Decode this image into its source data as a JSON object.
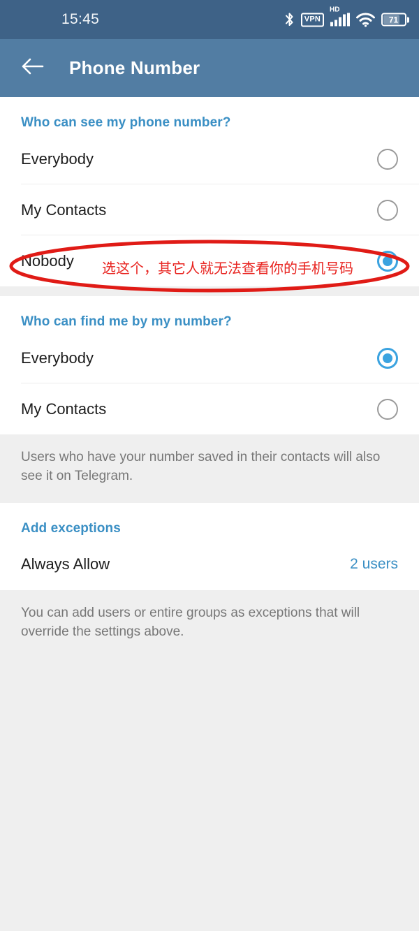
{
  "status_bar": {
    "time": "15:45",
    "icons": [
      "bluetooth-icon",
      "vpn-icon",
      "hd-icon",
      "cellular-signal-icon",
      "wifi-icon",
      "battery-icon"
    ],
    "vpn_label": "VPN",
    "hd_label": "HD",
    "battery_percent": "71"
  },
  "app_bar": {
    "back_icon": "back-arrow-icon",
    "title": "Phone Number",
    "background_color": "#527da3"
  },
  "sections": {
    "visibility": {
      "title": "Who can see my phone number?",
      "options": [
        {
          "label": "Everybody",
          "selected": false
        },
        {
          "label": "My Contacts",
          "selected": false
        },
        {
          "label": "Nobody",
          "selected": true
        }
      ]
    },
    "findability": {
      "title": "Who can find me by my number?",
      "options": [
        {
          "label": "Everybody",
          "selected": true
        },
        {
          "label": "My Contacts",
          "selected": false
        }
      ],
      "footnote": "Users who have your number saved in their contacts will also see it on Telegram."
    },
    "exceptions": {
      "title": "Add exceptions",
      "rows": [
        {
          "label": "Always Allow",
          "value": "2 users"
        }
      ],
      "footnote": "You can add users or entire groups as exceptions that will override the settings above."
    }
  },
  "annotation": {
    "text": "选这个，其它人就无法查看你的手机号码",
    "color": "#e01b16",
    "shape": "ellipse-highlight"
  },
  "colors": {
    "accent_blue": "#3a8fc4",
    "radio_selected": "#3ba3e0",
    "page_background": "#efefef",
    "card_background": "#ffffff",
    "annotation_red": "#e01b16"
  }
}
